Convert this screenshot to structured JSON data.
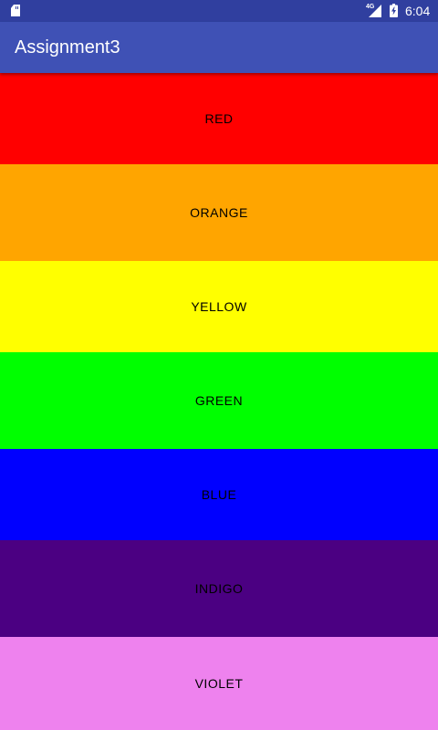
{
  "status_bar": {
    "time": "6:04",
    "network_type": "4G",
    "background": "#303f9f",
    "icons": [
      "sd-card-icon",
      "cell-signal-icon",
      "battery-charging-icon"
    ]
  },
  "app_bar": {
    "title": "Assignment3",
    "background": "#3f51b5"
  },
  "colors": [
    {
      "label": "RED",
      "color": "#ff0000"
    },
    {
      "label": "ORANGE",
      "color": "#ffa500"
    },
    {
      "label": "YELLOW",
      "color": "#ffff00"
    },
    {
      "label": "GREEN",
      "color": "#00ff00"
    },
    {
      "label": "BLUE",
      "color": "#0000ff"
    },
    {
      "label": "INDIGO",
      "color": "#4b0082"
    },
    {
      "label": "VIOLET",
      "color": "#ee82ee"
    }
  ]
}
